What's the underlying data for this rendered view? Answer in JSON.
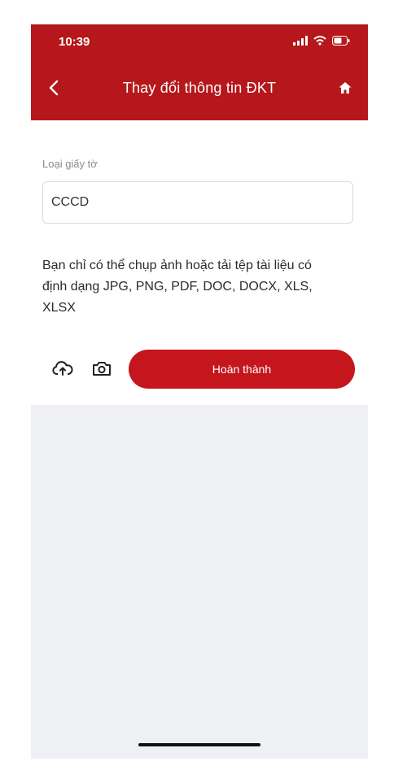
{
  "status_bar": {
    "time": "10:39"
  },
  "header": {
    "title": "Thay đổi thông tin ĐKT",
    "back_icon": "chevron-left-icon",
    "home_icon": "home-icon"
  },
  "form": {
    "document_type_label": "Loại giấy tờ",
    "document_type_value": "CCCD"
  },
  "note": "Bạn chỉ có thể chụp ảnh hoặc tải tệp tài liệu có định dạng JPG, PNG, PDF, DOC, DOCX, XLS, XLSX",
  "actions": {
    "upload_icon": "cloud-upload-icon",
    "camera_icon": "camera-icon",
    "done_label": "Hoàn thành"
  },
  "colors": {
    "header_bg": "#b5171b",
    "primary_button": "#c4161c",
    "preview_bg": "#eef0f4"
  }
}
